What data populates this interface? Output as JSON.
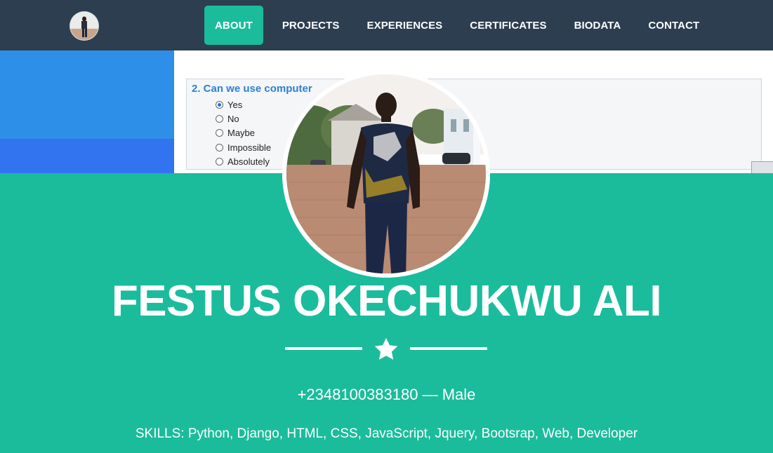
{
  "nav": {
    "items": [
      {
        "label": "ABOUT",
        "active": true
      },
      {
        "label": "PROJECTS",
        "active": false
      },
      {
        "label": "EXPERIENCES",
        "active": false
      },
      {
        "label": "CERTIFICATES",
        "active": false
      },
      {
        "label": "BIODATA",
        "active": false
      },
      {
        "label": "CONTACT",
        "active": false
      }
    ]
  },
  "quiz": {
    "question": "2.  Can we use computer",
    "options": [
      "Yes",
      "No",
      "Maybe",
      "Impossible",
      "Absolutely"
    ],
    "selected": "Yes"
  },
  "profile": {
    "name": "FESTUS OKECHUKWU ALI",
    "divider_icon": "star-icon",
    "phone": "+2348100383180",
    "separator": "—",
    "gender": "Male",
    "skills_label": "SKILLS:",
    "skills": "Python, Django, HTML, CSS, JavaScript, Jquery, Bootsrap, Web, Developer"
  },
  "colors": {
    "navbar": "#2c3e50",
    "accent": "#1abc9c",
    "text_light": "#ffffff"
  }
}
